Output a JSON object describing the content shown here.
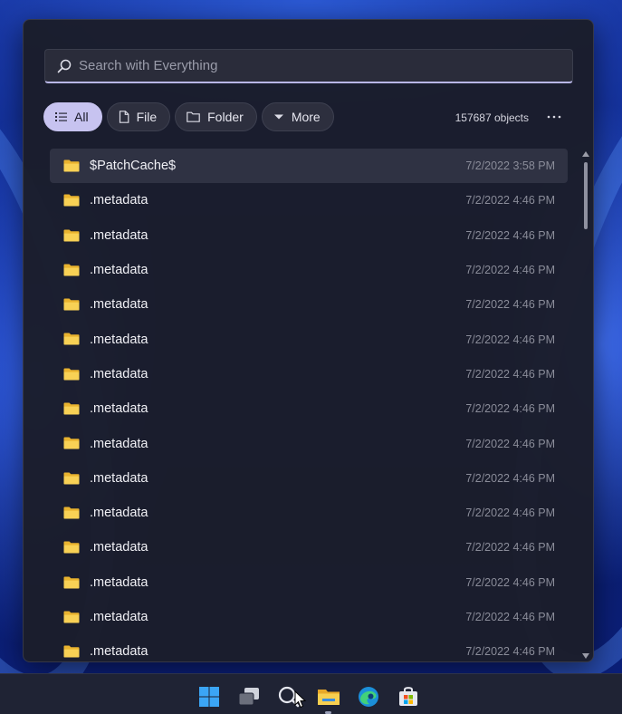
{
  "search": {
    "placeholder": "Search with Everything",
    "value": ""
  },
  "filters": [
    {
      "label": "All",
      "icon": "list-icon",
      "active": true
    },
    {
      "label": "File",
      "icon": "file-icon",
      "active": false
    },
    {
      "label": "Folder",
      "icon": "folder-outline-icon",
      "active": false
    },
    {
      "label": "More",
      "icon": "caret-down-icon",
      "active": false
    }
  ],
  "status": {
    "object_count": "157687 objects",
    "more_menu": "more-options-icon"
  },
  "results": [
    {
      "name": "$PatchCache$",
      "date": "7/2/2022 3:58 PM",
      "selected": true
    },
    {
      "name": ".metadata",
      "date": "7/2/2022 4:46 PM"
    },
    {
      "name": ".metadata",
      "date": "7/2/2022 4:46 PM"
    },
    {
      "name": ".metadata",
      "date": "7/2/2022 4:46 PM"
    },
    {
      "name": ".metadata",
      "date": "7/2/2022 4:46 PM"
    },
    {
      "name": ".metadata",
      "date": "7/2/2022 4:46 PM"
    },
    {
      "name": ".metadata",
      "date": "7/2/2022 4:46 PM"
    },
    {
      "name": ".metadata",
      "date": "7/2/2022 4:46 PM"
    },
    {
      "name": ".metadata",
      "date": "7/2/2022 4:46 PM"
    },
    {
      "name": ".metadata",
      "date": "7/2/2022 4:46 PM"
    },
    {
      "name": ".metadata",
      "date": "7/2/2022 4:46 PM"
    },
    {
      "name": ".metadata",
      "date": "7/2/2022 4:46 PM"
    },
    {
      "name": ".metadata",
      "date": "7/2/2022 4:46 PM"
    },
    {
      "name": ".metadata",
      "date": "7/2/2022 4:46 PM"
    },
    {
      "name": ".metadata",
      "date": "7/2/2022 4:46 PM"
    }
  ],
  "taskbar": {
    "icons": [
      "windows-start-icon",
      "task-view-icon",
      "search-icon",
      "file-explorer-icon",
      "edge-icon",
      "store-icon"
    ]
  },
  "colors": {
    "accent": "#c7c3f0",
    "folder": "#f5c842",
    "panel_bg": "#1b1d2a"
  }
}
